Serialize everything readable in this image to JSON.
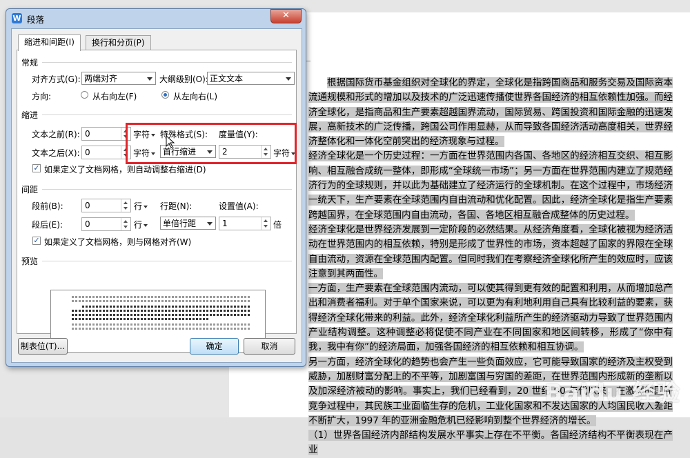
{
  "dialog": {
    "title": "段落",
    "app_icon_letter": "W",
    "close_symbol": "✕",
    "tabs": [
      {
        "label": "缩进和间距(I)",
        "active": true
      },
      {
        "label": "换行和分页(P)",
        "active": false
      }
    ],
    "general": {
      "section": "常规",
      "alignment_label": "对齐方式(G):",
      "alignment_value": "两端对齐",
      "outline_label": "大纲级别(O):",
      "outline_value": "正文文本",
      "direction_label": "方向:",
      "rtl_label": "从右向左(F)",
      "ltr_label": "从左向右(L)",
      "direction_selected": "ltr"
    },
    "indent": {
      "section": "缩进",
      "before_label": "文本之前(R):",
      "before_value": "0",
      "before_unit": "字符",
      "after_label": "文本之后(X):",
      "after_value": "0",
      "after_unit": "字符",
      "special_label": "特殊格式(S):",
      "special_value": "首行缩进",
      "measure_label": "度量值(Y):",
      "measure_value": "2",
      "measure_unit": "字符",
      "grid_check_label": "如果定义了文档网格，则自动调整右缩进(D)",
      "grid_checked": true
    },
    "spacing": {
      "section": "间距",
      "before_label": "段前(B):",
      "before_value": "0",
      "before_unit": "行",
      "after_label": "段后(E):",
      "after_value": "0",
      "after_unit": "行",
      "line_label": "行距(N):",
      "line_value": "单倍行距",
      "set_label": "设置值(A):",
      "set_value": "1",
      "set_unit": "倍",
      "grid_check_label": "如果定义了文档网格，则与网格对齐(W)",
      "grid_checked": true
    },
    "preview": {
      "section": "预览"
    },
    "buttons": {
      "tabs": "制表位(T)...",
      "ok": "确定",
      "cancel": "取消"
    }
  },
  "document": {
    "paragraphs": [
      "根据国际货币基金组织对全球化的界定，全球化是指跨国商品和服务交易及国际资本流通规模和形式的增加以及技术的广泛迅速传播使世界各国经济的相互依赖性加强。而经济全球化，是指商品和生产要素超越国界流动，国际贸易、跨国投资和国际金融的迅速发展，高新技术的广泛传播，跨国公司作用显赫，从而导致各国经济活动高度相关，世界经济整体化和一体化空前突出的经济现象与过程。",
      "经济全球化是一个历史过程：一方面在世界范围内各国、各地区的经济相互交织、相互影响、相互融合成统一整体，即形成“全球统一市场”；另一方面在世界范围内建立了规范经济行为的全球规则，并以此为基础建立了经济运行的全球机制。在这个过程中，市场经济一统天下，生产要素在全球范围内自由流动和优化配置。因此，经济全球化是指生产要素跨越国界，在全球范围内自由流动，各国、各地区相互融合成整体的历史过程。",
      "经济全球化是世界经济发展到一定阶段的必然结果。从经济角度看，全球化被视为经济活动在世界范围内的相互依赖，特别是形成了世界性的市场，资本超越了国家的界限在全球自由流动，资源在全球范围内配置。但同时我们在考察经济全球化所产生的效应时，应该注意到其两面性。",
      "一方面，生产要素在全球范围内流动，可以使其得到更有效的配置和利用，从而增加总产出和消费者福利。对于单个国家来说，可以更为有利地利用自己具有比较利益的要素，获得经济全球化带来的利益。此外，经济全球化利益所产生的经济驱动力导致了世界范围内产业结构调整。这种调整必将促使不同产业在不同国家和地区间转移，形成了“你中有我，我中有你”的经济局面，加强各国经济的相互依赖和相互协调。",
      "另一方面，经济全球化的趋势也会产生一些负面效应，它可能导致国家的经济及主权受到威胁，加剧财富分配上的不平等，加剧富国与穷国的差距，在世界范围内形成新的垄断以及加深经济被动的影响。事实上，我们已经看到，20 世纪 90 年代以来，在激烈的国际竞争过程中，其民族工业面临生存的危机，工业化国家和不发达国家的人均国民收入差距不断扩大，1997 年的亚洲金融危机已经影响到整个世界经济的增长。",
      "（1）世界各国经济内部结构发展水平事实上存在不平衡。各国经济结构不平衡表现在产业"
    ],
    "watermark": "Baidu 经验"
  }
}
